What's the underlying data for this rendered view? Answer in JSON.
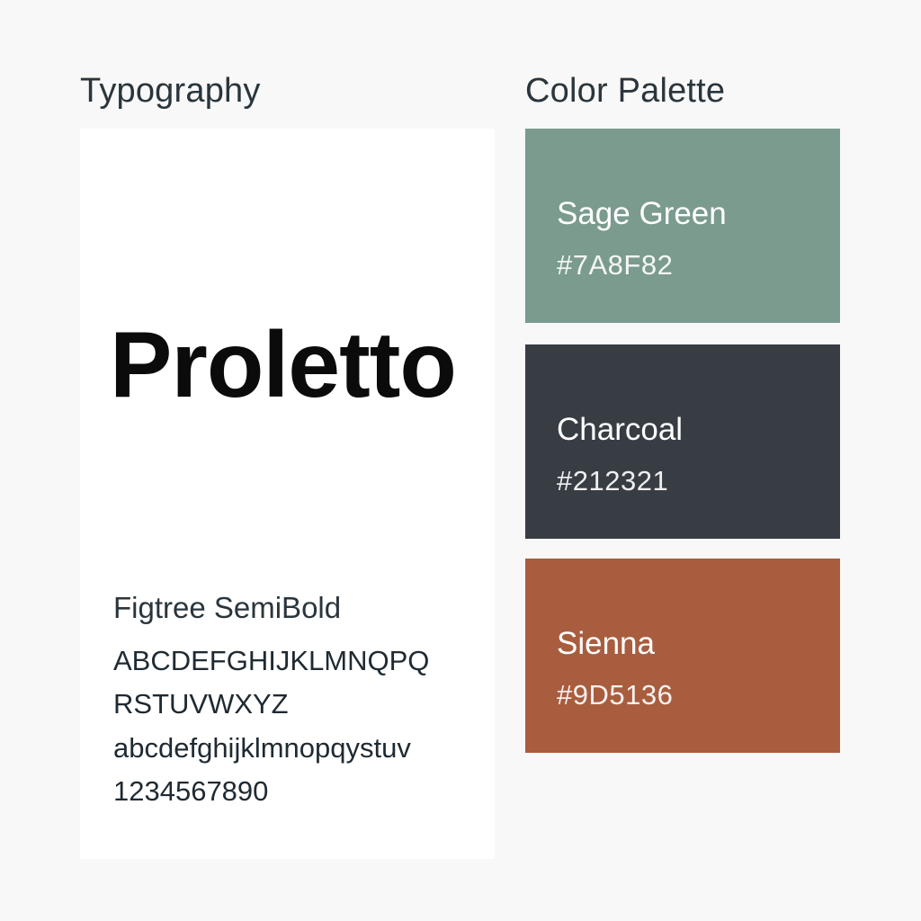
{
  "typography": {
    "heading": "Typography",
    "sample_word": "Proletto",
    "font_name": "Figtree SemiBold",
    "uppercase_line_1": "ABCDEFGHIJKLMNQPQ",
    "uppercase_line_2": "RSTUVWXYZ",
    "lowercase": "abcdefghijklmnopqystuv",
    "digits": "1234567890"
  },
  "palette": {
    "heading": "Color Palette",
    "swatches": [
      {
        "name": "Sage Green",
        "hex": "#7A8F82",
        "display_color": "#7a9b8e"
      },
      {
        "name": "Charcoal",
        "hex": "#212321",
        "display_color": "#383d44"
      },
      {
        "name": "Sienna",
        "hex": "#9D5136",
        "display_color": "#a95d3f"
      }
    ]
  }
}
